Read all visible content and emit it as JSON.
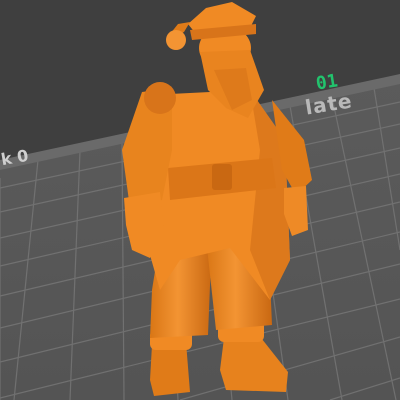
{
  "viewer": {
    "plate_number": "01",
    "plate_label": "late",
    "edge_text": "k 0"
  },
  "colors": {
    "background": "#3f3f3f",
    "bed": "#585858",
    "bed_grid": "#727272",
    "model": "#f08a24",
    "model_shadow": "#c86b16",
    "plate_number": "#22c36d"
  },
  "model": {
    "name": "santa-figure-icon"
  }
}
